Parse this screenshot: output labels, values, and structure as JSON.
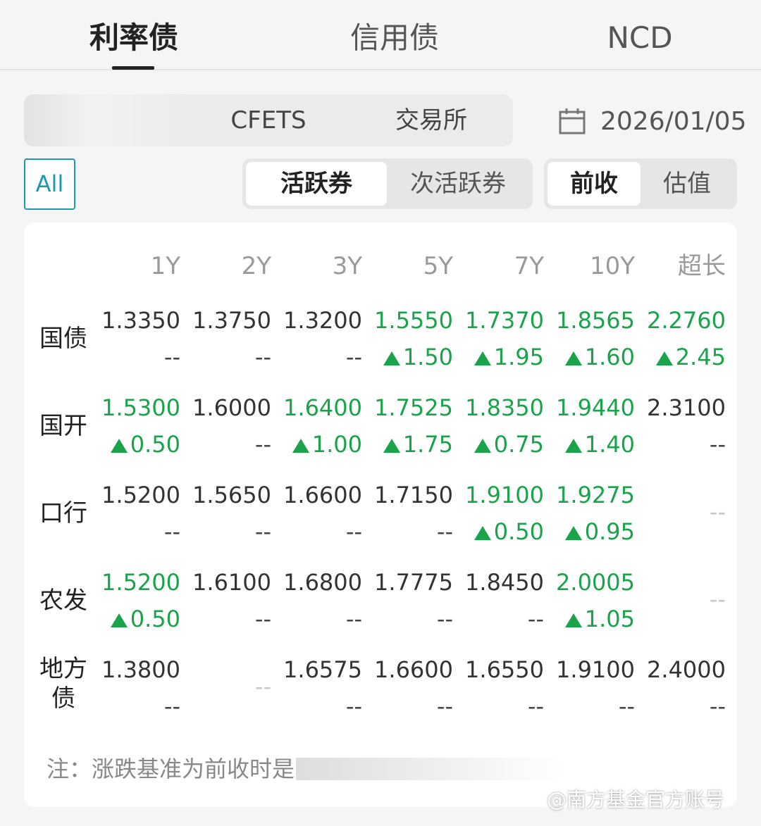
{
  "tabs": [
    "利率债",
    "信用债",
    "NCD"
  ],
  "market": [
    "CFETS",
    "交易所"
  ],
  "date": "2026/01/05",
  "filter_all": "All",
  "activity": [
    "活跃券",
    "次活跃券"
  ],
  "price_mode": [
    "前收",
    "估值"
  ],
  "headers": [
    "1Y",
    "2Y",
    "3Y",
    "5Y",
    "7Y",
    "10Y",
    "超长"
  ],
  "rows": [
    {
      "label": "国债",
      "values": [
        "1.3350",
        "1.3750",
        "1.3200",
        "1.5550",
        "1.7370",
        "1.8565",
        "2.2760"
      ],
      "changes": [
        "--",
        "--",
        "--",
        "1.50",
        "1.95",
        "1.60",
        "2.45"
      ],
      "up": [
        false,
        false,
        false,
        true,
        true,
        true,
        true
      ]
    },
    {
      "label": "国开",
      "values": [
        "1.5300",
        "1.6000",
        "1.6400",
        "1.7525",
        "1.8350",
        "1.9440",
        "2.3100"
      ],
      "changes": [
        "0.50",
        "--",
        "1.00",
        "1.75",
        "0.75",
        "1.40",
        "--"
      ],
      "up": [
        true,
        false,
        true,
        true,
        true,
        true,
        false
      ]
    },
    {
      "label": "口行",
      "values": [
        "1.5200",
        "1.5650",
        "1.6600",
        "1.7150",
        "1.9100",
        "1.9275",
        ""
      ],
      "changes": [
        "--",
        "--",
        "--",
        "--",
        "0.50",
        "0.95",
        ""
      ],
      "up": [
        false,
        false,
        false,
        false,
        true,
        true,
        false
      ],
      "empty_mark": "--"
    },
    {
      "label": "农发",
      "values": [
        "1.5200",
        "1.6100",
        "1.6800",
        "1.7775",
        "1.8450",
        "2.0005",
        ""
      ],
      "changes": [
        "0.50",
        "--",
        "--",
        "--",
        "--",
        "1.05",
        ""
      ],
      "up": [
        true,
        false,
        false,
        false,
        false,
        true,
        false
      ],
      "empty_mark": "--"
    },
    {
      "label": "地方\n债",
      "values": [
        "1.3800",
        "",
        "1.6575",
        "1.6600",
        "1.6550",
        "1.9100",
        "2.4000"
      ],
      "changes": [
        "--",
        "",
        "--",
        "--",
        "--",
        "--",
        "--"
      ],
      "up": [
        false,
        false,
        false,
        false,
        false,
        false,
        false
      ],
      "empty_mark": "--"
    }
  ],
  "note": "注：涨跌基准为前收时是",
  "watermark": "@南方基金官方账号",
  "colors": {
    "up_green": "#1aa34a",
    "accent": "#1a9ab0"
  }
}
